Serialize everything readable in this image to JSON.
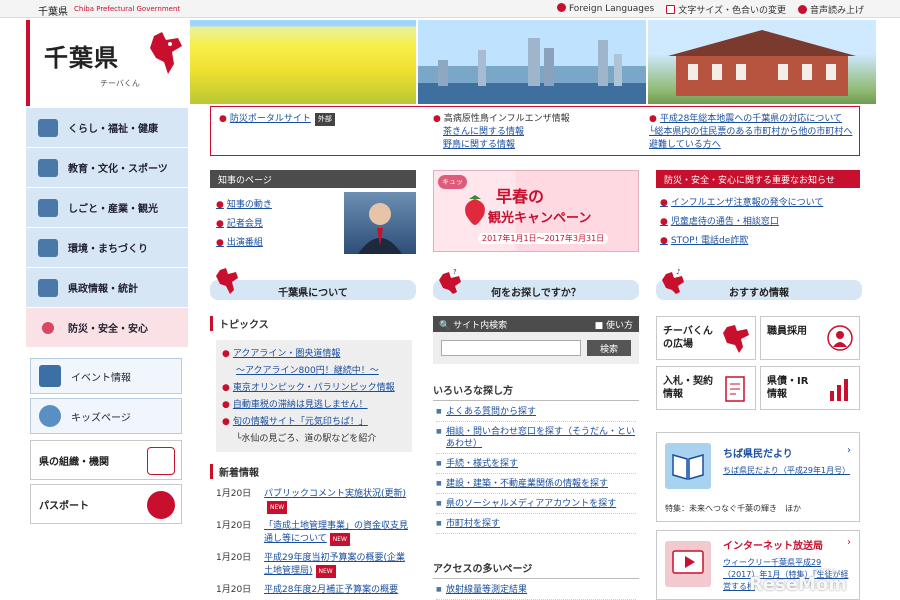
{
  "topbar": {
    "brand": "千葉県",
    "brand_en": "Chiba Prefectural Government",
    "links": [
      "Foreign Languages",
      "文字サイズ・色合いの変更",
      "音声読み上げ"
    ]
  },
  "logo": {
    "title": "千葉県",
    "mascot": "チーバくん"
  },
  "nav": [
    "くらし・福祉・健康",
    "教育・文化・スポーツ",
    "しごと・産業・観光",
    "環境・まちづくり",
    "県政情報・統計",
    "防災・安全・安心"
  ],
  "side_links": [
    "イベント情報",
    "キッズページ"
  ],
  "side_boxes": [
    "県の組織・機関",
    "パスポート"
  ],
  "alert": {
    "col1": "防災ポータルサイト",
    "col1_tag": "外部",
    "col2_title": "高病原性鳥インフルエンザ情報",
    "col2_sub1": "茶きんに関する情報",
    "col2_sub2": "野鳥に関する情報",
    "col3": "平成28年総本地震への千葉県の対応について",
    "col3_sub": "└総本県内の住民票のある市町村から他の市町村へ避難している方へ"
  },
  "governor": {
    "header": "知事のページ",
    "links": [
      "知事の動き",
      "記者会見",
      "出演番組"
    ]
  },
  "campaign": {
    "badge": "キュッ",
    "title1": "早春の",
    "title2": "観光キャンペーン",
    "period": "2017年1月1日～2017年3月31日"
  },
  "important": {
    "header": "防災・安全・安心に関する重要なお知らせ",
    "links": [
      "インフルエンザ注意報の発令について",
      "児童虐待の通告・相談窓口",
      "STOP! 電話de詐欺"
    ]
  },
  "sections": {
    "about": "千葉県について",
    "search": "何をお探しですか？",
    "recommend": "おすすめ情報"
  },
  "topics": {
    "header": "トピックス",
    "items": [
      "アクアライン・圏央道情報",
      "～アクアライン800円！継続中！～",
      "東京オリンピック・パラリンピック情報",
      "自動車税の滞納は見逃しません！",
      "旬の情報サイト「元気印ちば！」",
      "└水仙の見ごろ、道の駅などを紹介"
    ]
  },
  "news": {
    "header": "新着情報",
    "items": [
      {
        "date": "1月20日",
        "text": "パブリックコメント実施状況(更新)",
        "new": "NEW"
      },
      {
        "date": "1月20日",
        "text": "「造成土地管理事業」の資金収支見通し等について",
        "new": "NEW"
      },
      {
        "date": "1月20日",
        "text": "平成29年度当初予算案の概要(企業土地管理局)",
        "new": "NEW"
      },
      {
        "date": "1月20日",
        "text": "平成28年度2月補正予算案の概要",
        "new": ""
      }
    ]
  },
  "search": {
    "header": "サイト内検索",
    "help": "使い方",
    "placeholder": "",
    "button": "検索"
  },
  "various": {
    "header": "いろいろな探し方",
    "items": [
      "よくある質問から探す",
      "相談・問い合わせ窓口を探す（そうだん・といあわせ）",
      "手続・様式を探す",
      "建設・建築・不動産業関係の情報を探す",
      "県のソーシャルメディアアカウントを探す",
      "市町村を探す"
    ]
  },
  "access": {
    "header": "アクセスの多いページ",
    "items": [
      "放射線量等測定結果"
    ]
  },
  "tiles": [
    {
      "label1": "チーバくん",
      "label2": "の広場"
    },
    {
      "label1": "職員採用",
      "label2": ""
    },
    {
      "label1": "入札・契約",
      "label2": "情報"
    },
    {
      "label1": "県債・IR",
      "label2": "情報"
    }
  ],
  "dayori": {
    "header": "ちば県民だより",
    "text": "ちば県民だより（平成29年1月号）",
    "feature": "特集：未来へつなぐ千葉の輝き　ほか"
  },
  "internet": {
    "header": "インターネット放送局",
    "text": "ウィークリー千葉県平成29（2017）年1月（特集）「生徒が経営する模"
  },
  "watermark": {
    "text": "ReseMom",
    "sub": "リセマム"
  },
  "colors": {
    "accent": "#c8102e",
    "nav_bg": "#d7e6f5",
    "link": "#1a4fa0"
  }
}
